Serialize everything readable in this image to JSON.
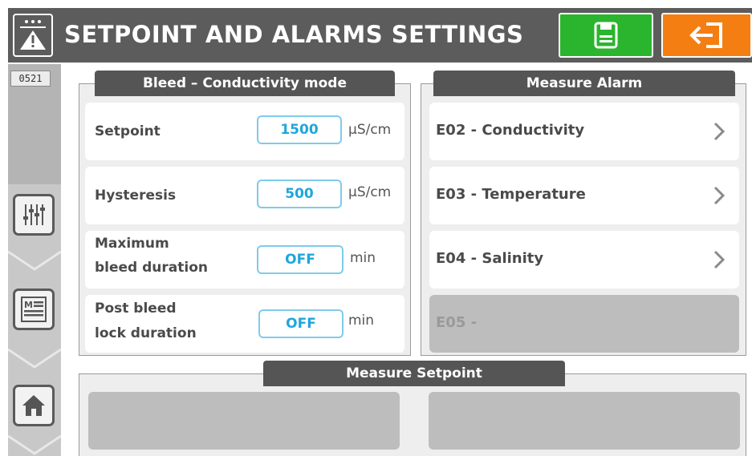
{
  "header": {
    "title": "SETPOINT AND ALARMS SETTINGS",
    "logo_icon": "warning-panel-icon",
    "save_icon": "save-icon",
    "exit_icon": "exit-icon",
    "colors": {
      "bar": "#5c5c5c",
      "save": "#2bb52e",
      "exit": "#f57e12"
    }
  },
  "sidebar": {
    "code": "0521",
    "items": [
      {
        "icon": "sliders-icon"
      },
      {
        "icon": "menu-list-icon"
      },
      {
        "icon": "home-icon"
      }
    ]
  },
  "bleed_panel": {
    "title": "Bleed – Conductivity  mode",
    "rows": [
      {
        "label": "Setpoint",
        "value": "1500",
        "unit": "µS/cm"
      },
      {
        "label": "Hysteresis",
        "value": "500",
        "unit": "µS/cm"
      },
      {
        "label_line1": "Maximum",
        "label_line2": "bleed duration",
        "value": "OFF",
        "unit": "min"
      },
      {
        "label_line1": "Post bleed",
        "label_line2": "lock duration",
        "value": "OFF",
        "unit": "min"
      }
    ]
  },
  "alarm_panel": {
    "title": "Measure Alarm",
    "items": [
      {
        "label": "E02 - Conductivity",
        "enabled": true
      },
      {
        "label": "E03 - Temperature",
        "enabled": true
      },
      {
        "label": "E04 - Salinity",
        "enabled": true
      },
      {
        "label": "E05 -",
        "enabled": false
      }
    ]
  },
  "setpoint_panel": {
    "title": "Measure Setpoint"
  },
  "accent_color": "#1ea6dd"
}
